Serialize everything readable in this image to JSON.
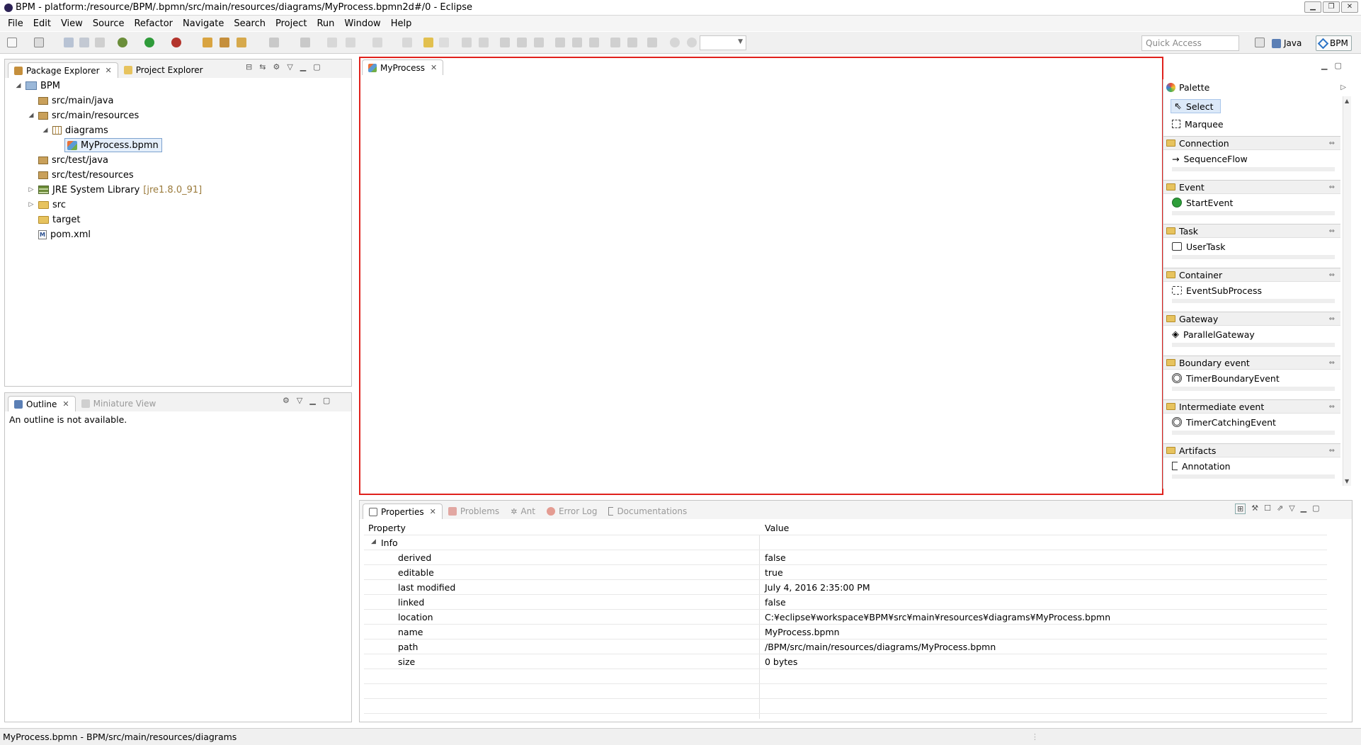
{
  "window": {
    "title": "BPM - platform:/resource/BPM/.bpmn/src/main/resources/diagrams/MyProcess.bpmn2d#/0 - Eclipse",
    "controls": [
      "minimize-icon",
      "restore-icon",
      "close-icon"
    ]
  },
  "menu": [
    "File",
    "Edit",
    "View",
    "Source",
    "Refactor",
    "Navigate",
    "Search",
    "Project",
    "Run",
    "Window",
    "Help"
  ],
  "toolbar": {
    "quick_access_placeholder": "Quick Access",
    "perspective_java": "Java",
    "perspective_bpm": "BPM"
  },
  "explorer": {
    "tabs": [
      "Package Explorer",
      "Project Explorer"
    ],
    "tree": [
      {
        "label": "BPM",
        "icon": "project-icon"
      },
      {
        "label": "src/main/java",
        "icon": "source-folder-icon"
      },
      {
        "label": "src/main/resources",
        "icon": "source-folder-icon"
      },
      {
        "label": "diagrams",
        "icon": "package-icon"
      },
      {
        "label": "MyProcess.bpmn",
        "icon": "bpmn-file-icon"
      },
      {
        "label": "src/test/java",
        "icon": "source-folder-icon"
      },
      {
        "label": "src/test/resources",
        "icon": "source-folder-icon"
      },
      {
        "label": "JRE System Library",
        "suffix": "[jre1.8.0_91]",
        "icon": "library-icon"
      },
      {
        "label": "src",
        "icon": "folder-icon"
      },
      {
        "label": "target",
        "icon": "folder-icon"
      },
      {
        "label": "pom.xml",
        "icon": "maven-file-icon"
      }
    ]
  },
  "outline": {
    "tabs": [
      "Outline",
      "Miniature View"
    ],
    "message": "An outline is not available."
  },
  "editor": {
    "tab": "MyProcess"
  },
  "palette": {
    "title": "Palette",
    "tools": [
      "Select",
      "Marquee"
    ],
    "drawers": [
      {
        "name": "Connection",
        "first": "SequenceFlow"
      },
      {
        "name": "Event",
        "first": "StartEvent"
      },
      {
        "name": "Task",
        "first": "UserTask"
      },
      {
        "name": "Container",
        "first": "EventSubProcess"
      },
      {
        "name": "Gateway",
        "first": "ParallelGateway"
      },
      {
        "name": "Boundary event",
        "first": "TimerBoundaryEvent"
      },
      {
        "name": "Intermediate event",
        "first": "TimerCatchingEvent"
      },
      {
        "name": "Artifacts",
        "first": "Annotation"
      }
    ]
  },
  "properties": {
    "tabs": [
      "Properties",
      "Problems",
      "Ant",
      "Error Log",
      "Documentations"
    ],
    "col_property": "Property",
    "col_value": "Value",
    "group": "Info",
    "rows": [
      {
        "k": "derived",
        "v": "false"
      },
      {
        "k": "editable",
        "v": "true"
      },
      {
        "k": "last modified",
        "v": "July 4, 2016 2:35:00 PM"
      },
      {
        "k": "linked",
        "v": "false"
      },
      {
        "k": "location",
        "v": "C:¥eclipse¥workspace¥BPM¥src¥main¥resources¥diagrams¥MyProcess.bpmn"
      },
      {
        "k": "name",
        "v": "MyProcess.bpmn"
      },
      {
        "k": "path",
        "v": "/BPM/src/main/resources/diagrams/MyProcess.bpmn"
      },
      {
        "k": "size",
        "v": "0  bytes"
      }
    ]
  },
  "status": {
    "text": "MyProcess.bpmn - BPM/src/main/resources/diagrams"
  }
}
